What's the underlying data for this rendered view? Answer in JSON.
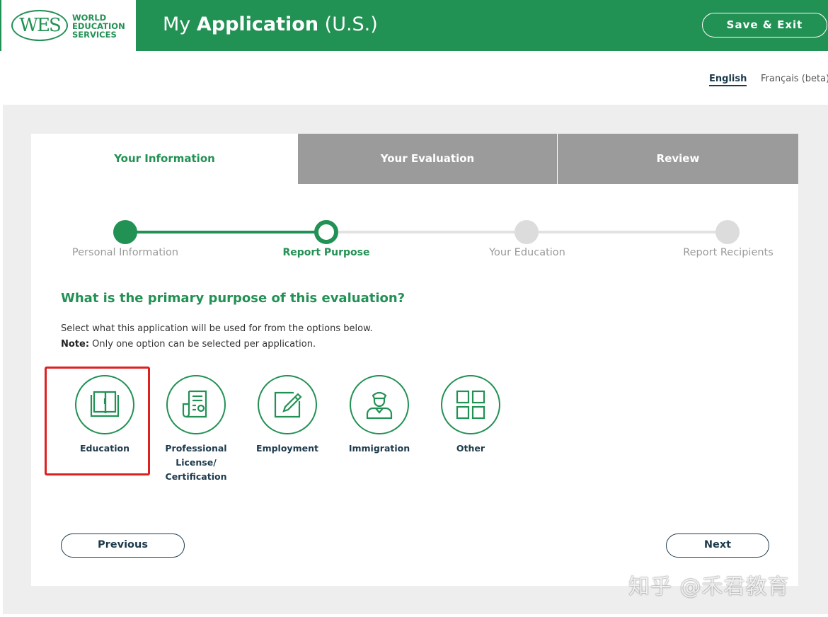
{
  "header": {
    "logo_mark": "WES",
    "logo_lines": [
      "WORLD",
      "EDUCATION",
      "SERVICES"
    ],
    "title_prefix": "My ",
    "title_bold": "Application",
    "title_suffix": " (U.S.)",
    "save_exit_label": "Save & Exit",
    "background_color": "#229154"
  },
  "language": {
    "active": "English",
    "other": "Français (beta)"
  },
  "tabs": [
    {
      "label": "Your Information",
      "state": "active"
    },
    {
      "label": "Your Evaluation",
      "state": "inactive"
    },
    {
      "label": "Review",
      "state": "inactive"
    }
  ],
  "steps": [
    {
      "label": "Personal Information",
      "state": "complete"
    },
    {
      "label": "Report Purpose",
      "state": "current"
    },
    {
      "label": "Your Education",
      "state": "upcoming"
    },
    {
      "label": "Report Recipients",
      "state": "upcoming"
    }
  ],
  "question": "What is the primary purpose of this evaluation?",
  "instructions": {
    "line1": "Select what this application will be used for from the options below.",
    "note_label": "Note:",
    "note_text": " Only one option can be selected per application."
  },
  "options": [
    {
      "label": "Education",
      "icon": "book-icon",
      "highlighted": true
    },
    {
      "label_lines": [
        "Professional",
        "License/",
        "Certification"
      ],
      "icon": "certificate-icon"
    },
    {
      "label": "Employment",
      "icon": "edit-icon"
    },
    {
      "label": "Immigration",
      "icon": "officer-icon"
    },
    {
      "label": "Other",
      "icon": "grid-icon"
    }
  ],
  "buttons": {
    "previous": "Previous",
    "next": "Next"
  },
  "watermark": "知乎 @禾君教育",
  "colors": {
    "brand_green": "#229154",
    "tab_inactive": "#9b9b9b",
    "navy": "#1d3a4c",
    "highlight_red": "#dd2020"
  }
}
